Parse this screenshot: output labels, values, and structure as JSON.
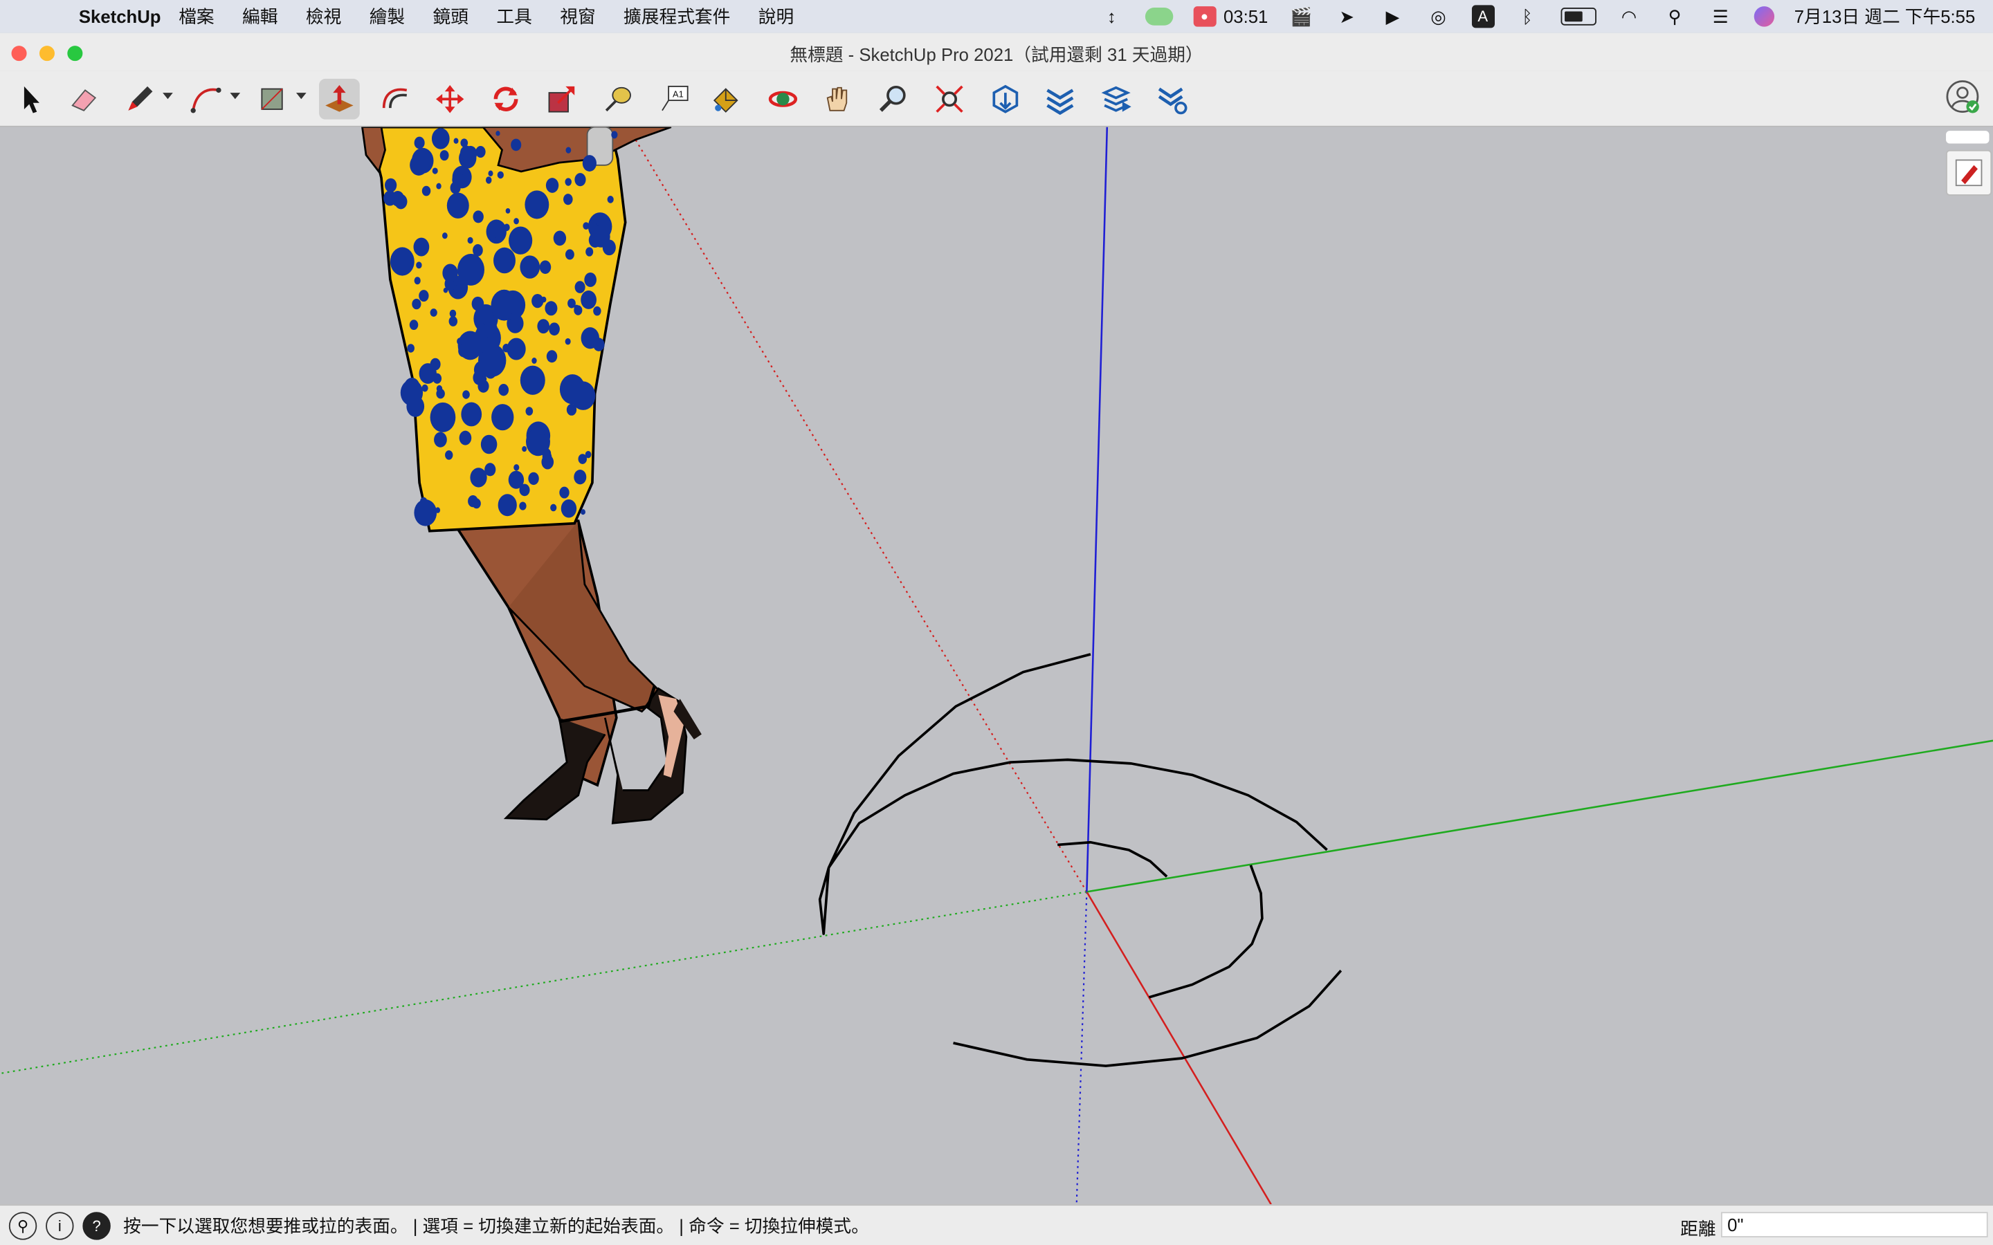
{
  "menubar": {
    "app_name": "SketchUp",
    "menus": [
      "檔案",
      "編輯",
      "檢視",
      "繪製",
      "鏡頭",
      "工具",
      "視窗",
      "擴展程式套件",
      "說明"
    ],
    "clock_time": "03:51",
    "datetime": "7月13日 週二 下午5:55",
    "input_source": "A"
  },
  "window": {
    "title": "無標題 - SketchUp Pro 2021（試用還剩 31 天過期）",
    "traffic_lights": {
      "close": "#ff5f57",
      "minimize": "#febc2e",
      "zoom": "#28c840"
    }
  },
  "toolbar": {
    "tools": [
      {
        "name": "select-tool",
        "icon": "arrow-icon"
      },
      {
        "name": "eraser-tool",
        "icon": "eraser-icon"
      },
      {
        "name": "line-tool",
        "icon": "pencil-icon"
      },
      {
        "name": "arc-tool",
        "icon": "arc-icon"
      },
      {
        "name": "rectangle-tool",
        "icon": "rectangle-icon"
      },
      {
        "name": "push-pull-tool",
        "icon": "push-pull-icon",
        "active": true
      },
      {
        "name": "offset-tool",
        "icon": "offset-icon"
      },
      {
        "name": "move-tool",
        "icon": "move-icon"
      },
      {
        "name": "rotate-tool",
        "icon": "rotate-icon"
      },
      {
        "name": "scale-tool",
        "icon": "scale-icon"
      },
      {
        "name": "tape-measure-tool",
        "icon": "tape-icon"
      },
      {
        "name": "text-tool",
        "icon": "text-icon"
      },
      {
        "name": "paint-bucket-tool",
        "icon": "paint-icon"
      },
      {
        "name": "orbit-tool",
        "icon": "orbit-icon"
      },
      {
        "name": "pan-tool",
        "icon": "hand-icon"
      },
      {
        "name": "zoom-tool",
        "icon": "magnifier-icon"
      },
      {
        "name": "zoom-extents-tool",
        "icon": "zoom-extents-icon"
      },
      {
        "name": "warehouse-tool",
        "icon": "warehouse-icon"
      },
      {
        "name": "extension-warehouse-tool",
        "icon": "extension-icon"
      },
      {
        "name": "send-to-layout-tool",
        "icon": "layers-icon"
      },
      {
        "name": "extension-manager-tool",
        "icon": "extension-gear-icon"
      }
    ],
    "text_tool_label": "A1"
  },
  "viewport": {
    "background": "#c0c1c5",
    "axis_colors": {
      "red": "#d41f1f",
      "green": "#1faa1f",
      "blue": "#1f1fd4"
    },
    "model": "figure-person-in-polka-dot-skirt"
  },
  "statusbar": {
    "hint": "按一下以選取您想要推或拉的表面。 | 選項 = 切換建立新的起始表面。 | 命令 = 切換拉伸模式。",
    "measure_label": "距離",
    "measure_value": "0\""
  }
}
